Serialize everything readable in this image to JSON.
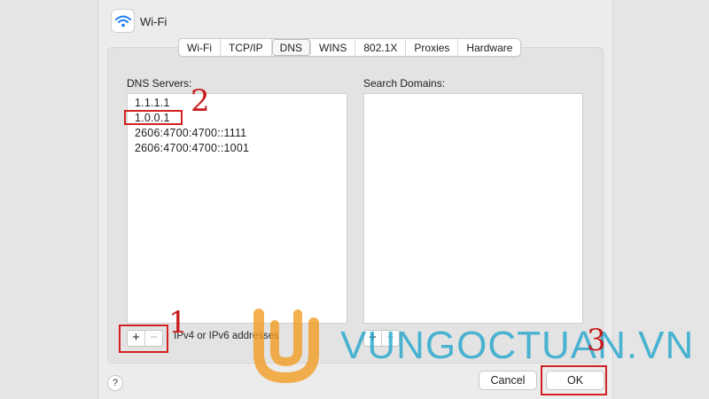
{
  "window": {
    "title": "Wi-Fi",
    "icon": "wifi-icon"
  },
  "tabs": [
    {
      "label": "Wi-Fi",
      "active": false
    },
    {
      "label": "TCP/IP",
      "active": false
    },
    {
      "label": "DNS",
      "active": true
    },
    {
      "label": "WINS",
      "active": false
    },
    {
      "label": "802.1X",
      "active": false
    },
    {
      "label": "Proxies",
      "active": false
    },
    {
      "label": "Hardware",
      "active": false
    }
  ],
  "dns": {
    "label": "DNS Servers:",
    "servers": [
      "1.1.1.1",
      "1.0.0.1",
      "2606:4700:4700::1111",
      "2606:4700:4700::1001"
    ],
    "add": "+",
    "remove": "−",
    "hint": "IPv4 or IPv6 addresses"
  },
  "search": {
    "label": "Search Domains:",
    "add": "+",
    "remove": "−"
  },
  "footer": {
    "help": "?",
    "cancel": "Cancel",
    "ok": "OK"
  },
  "annotations": {
    "n1": "1",
    "n2": "2",
    "n3": "3",
    "color": "#d42020"
  },
  "watermark": {
    "text": "VUNGOCTUAN.VN",
    "orange": "#f39b1e",
    "blue": "#1ea5cc"
  }
}
